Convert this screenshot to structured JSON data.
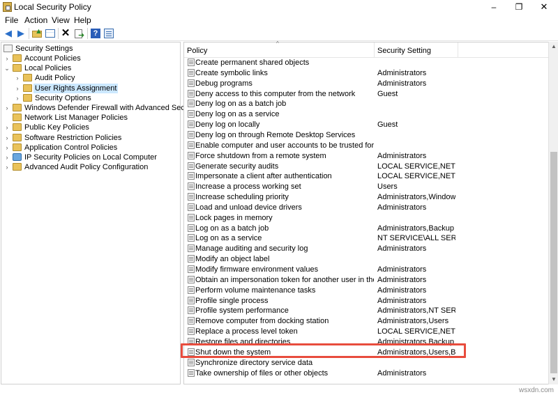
{
  "window": {
    "title": "Local Security Policy",
    "minimize": "–",
    "maximize": "❐",
    "close": "✕"
  },
  "menu": [
    "File",
    "Action",
    "View",
    "Help"
  ],
  "toolbar_icons": [
    "back-arrow-icon",
    "forward-arrow-icon",
    "up-folder-icon",
    "show-hide-tree-icon",
    "delete-icon",
    "export-list-icon",
    "help-icon",
    "properties-icon"
  ],
  "tree": {
    "root": "Security Settings",
    "items": [
      {
        "label": "Account Policies",
        "level": 1,
        "icon": "folder-icon",
        "expander": "›"
      },
      {
        "label": "Local Policies",
        "level": 1,
        "icon": "folder-icon",
        "expander": "⌄"
      },
      {
        "label": "Audit Policy",
        "level": 2,
        "icon": "folder-icon",
        "expander": "›"
      },
      {
        "label": "User Rights Assignment",
        "level": 2,
        "icon": "folder-icon",
        "expander": "›",
        "selected": true
      },
      {
        "label": "Security Options",
        "level": 2,
        "icon": "folder-icon",
        "expander": "›"
      },
      {
        "label": "Windows Defender Firewall with Advanced Security",
        "level": 1,
        "icon": "folder-icon",
        "expander": "›"
      },
      {
        "label": "Network List Manager Policies",
        "level": 1,
        "icon": "folder-icon",
        "expander": ""
      },
      {
        "label": "Public Key Policies",
        "level": 1,
        "icon": "folder-icon",
        "expander": "›"
      },
      {
        "label": "Software Restriction Policies",
        "level": 1,
        "icon": "folder-icon",
        "expander": "›"
      },
      {
        "label": "Application Control Policies",
        "level": 1,
        "icon": "folder-icon",
        "expander": "›"
      },
      {
        "label": "IP Security Policies on Local Computer",
        "level": 1,
        "icon": "network-icon",
        "expander": "›"
      },
      {
        "label": "Advanced Audit Policy Configuration",
        "level": 1,
        "icon": "folder-icon",
        "expander": "›"
      }
    ]
  },
  "list": {
    "columns": [
      "Policy",
      "Security Setting"
    ],
    "sort_indicator": "^",
    "rows": [
      {
        "policy": "Create permanent shared objects",
        "setting": ""
      },
      {
        "policy": "Create symbolic links",
        "setting": "Administrators"
      },
      {
        "policy": "Debug programs",
        "setting": "Administrators"
      },
      {
        "policy": "Deny access to this computer from the network",
        "setting": "Guest"
      },
      {
        "policy": "Deny log on as a batch job",
        "setting": ""
      },
      {
        "policy": "Deny log on as a service",
        "setting": ""
      },
      {
        "policy": "Deny log on locally",
        "setting": "Guest"
      },
      {
        "policy": "Deny log on through Remote Desktop Services",
        "setting": ""
      },
      {
        "policy": "Enable computer and user accounts to be trusted for delega...",
        "setting": ""
      },
      {
        "policy": "Force shutdown from a remote system",
        "setting": "Administrators"
      },
      {
        "policy": "Generate security audits",
        "setting": "LOCAL SERVICE,NETWO..."
      },
      {
        "policy": "Impersonate a client after authentication",
        "setting": "LOCAL SERVICE,NETWO..."
      },
      {
        "policy": "Increase a process working set",
        "setting": "Users"
      },
      {
        "policy": "Increase scheduling priority",
        "setting": "Administrators,Window ..."
      },
      {
        "policy": "Load and unload device drivers",
        "setting": "Administrators"
      },
      {
        "policy": "Lock pages in memory",
        "setting": ""
      },
      {
        "policy": "Log on as a batch job",
        "setting": "Administrators,Backup ..."
      },
      {
        "policy": "Log on as a service",
        "setting": "NT SERVICE\\ALL SERVICES"
      },
      {
        "policy": "Manage auditing and security log",
        "setting": "Administrators"
      },
      {
        "policy": "Modify an object label",
        "setting": ""
      },
      {
        "policy": "Modify firmware environment values",
        "setting": "Administrators"
      },
      {
        "policy": "Obtain an impersonation token for another user in the same...",
        "setting": "Administrators"
      },
      {
        "policy": "Perform volume maintenance tasks",
        "setting": "Administrators"
      },
      {
        "policy": "Profile single process",
        "setting": "Administrators"
      },
      {
        "policy": "Profile system performance",
        "setting": "Administrators,NT SERVI..."
      },
      {
        "policy": "Remove computer from docking station",
        "setting": "Administrators,Users"
      },
      {
        "policy": "Replace a process level token",
        "setting": "LOCAL SERVICE,NETWO..."
      },
      {
        "policy": "Restore files and directories",
        "setting": "Administrators,Backup ..."
      },
      {
        "policy": "Shut down the system",
        "setting": "Administrators,Users,Ba...",
        "highlighted": true
      },
      {
        "policy": "Synchronize directory service data",
        "setting": ""
      },
      {
        "policy": "Take ownership of files or other objects",
        "setting": "Administrators"
      }
    ]
  },
  "scrollbar": {
    "up": "▲",
    "down": "▼",
    "position": 0.95
  },
  "highlight_color": "#e84c3d",
  "watermark": "wsxdn.com"
}
